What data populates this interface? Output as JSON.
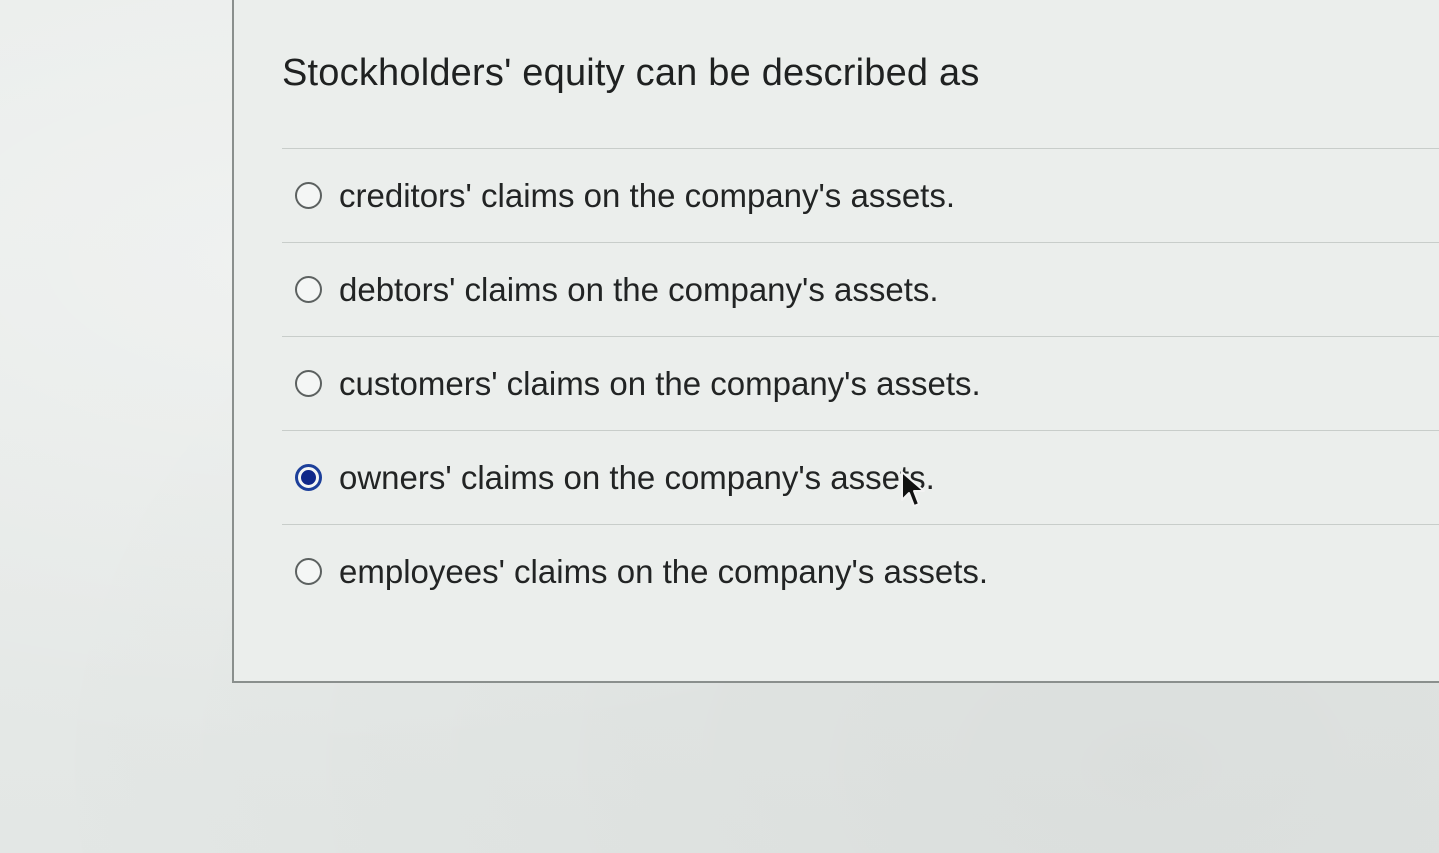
{
  "question": {
    "text": "Stockholders' equity can be described as"
  },
  "options": [
    {
      "label": "creditors' claims on the company's assets.",
      "selected": false
    },
    {
      "label": "debtors' claims on the company's assets.",
      "selected": false
    },
    {
      "label": "customers' claims on the company's assets.",
      "selected": false
    },
    {
      "label": "owners' claims on the company's assets.",
      "selected": true
    },
    {
      "label": "employees' claims on the company's assets.",
      "selected": false
    }
  ],
  "colors": {
    "selected_radio": "#1c3f9a",
    "background": "#e6e9e7"
  },
  "icons": {
    "cursor": "mouse-pointer-icon"
  }
}
